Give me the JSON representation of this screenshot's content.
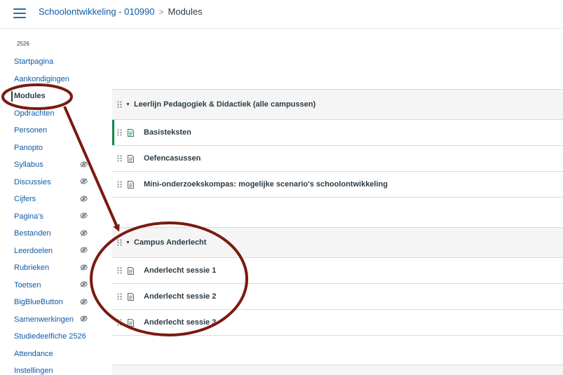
{
  "header": {
    "course_link": "Schoolontwikkeling - 010990",
    "separator": ">",
    "current_page": "Modules"
  },
  "sidebar": {
    "term": "2526",
    "items": [
      {
        "label": "Startpagina",
        "hidden": false
      },
      {
        "label": "Aankondigingen",
        "hidden": false
      },
      {
        "label": "Modules",
        "hidden": false,
        "active": true
      },
      {
        "label": "Opdrachten",
        "hidden": false
      },
      {
        "label": "Personen",
        "hidden": false
      },
      {
        "label": "Panopto",
        "hidden": false
      },
      {
        "label": "Syllabus",
        "hidden": true
      },
      {
        "label": "Discussies",
        "hidden": true
      },
      {
        "label": "Cijfers",
        "hidden": true
      },
      {
        "label": "Pagina's",
        "hidden": true
      },
      {
        "label": "Bestanden",
        "hidden": true
      },
      {
        "label": "Leerdoelen",
        "hidden": true
      },
      {
        "label": "Rubrieken",
        "hidden": true
      },
      {
        "label": "Toetsen",
        "hidden": true
      },
      {
        "label": "BigBlueButton",
        "hidden": true
      },
      {
        "label": "Samenwerkingen",
        "hidden": true
      },
      {
        "label": "Studiedeelfiche 2526",
        "hidden": false
      },
      {
        "label": "Attendance",
        "hidden": false
      },
      {
        "label": "Instellingen",
        "hidden": false
      }
    ]
  },
  "modules": [
    {
      "title": "Leerlijn Pedagogiek & Didactiek (alle campussen)",
      "items": [
        {
          "title": "Basisteksten",
          "published": true
        },
        {
          "title": "Oefencasussen",
          "published": false
        },
        {
          "title": "Mini-onderzoekskompas: mogelijke scenario's schoolontwikkeling",
          "published": false
        }
      ]
    },
    {
      "title": "Campus Anderlecht",
      "items": [
        {
          "title": "Anderlecht sessie 1",
          "published": false
        },
        {
          "title": "Anderlecht sessie 2",
          "published": false
        },
        {
          "title": "Anderlecht sessie 3",
          "published": false
        }
      ]
    }
  ],
  "colors": {
    "link": "#0e5aa7",
    "text": "#2d3b45",
    "published_bar": "#0b874b",
    "annotation": "#7b1a10"
  },
  "icons": {
    "menu": "hamburger-menu-icon",
    "hidden": "eye-slash-icon",
    "drag": "drag-handle-icon",
    "page": "page-icon",
    "collapse": "caret-down-icon"
  }
}
